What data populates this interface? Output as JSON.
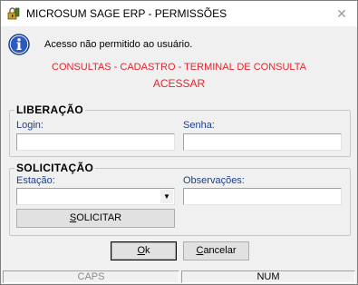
{
  "window": {
    "title": "MICROSUM SAGE ERP - PERMISSÕES",
    "close_glyph": "✕"
  },
  "message": {
    "text": "Acesso não permitido ao usuário.",
    "permission_path": "CONSULTAS - CADASTRO - TERMINAL DE CONSULTA",
    "permission_name": "ACESSAR",
    "accent_color": "#e3262c"
  },
  "liberacao": {
    "legend": "LIBERAÇÃO",
    "login_label": "Login:",
    "login_value": "",
    "senha_label": "Senha:",
    "senha_value": ""
  },
  "solicitacao": {
    "legend": "SOLICITAÇÃO",
    "estacao_label": "Estação:",
    "estacao_value": "",
    "observacoes_label": "Observações:",
    "observacoes_value": "",
    "solicitar_button": "SOLICITAR"
  },
  "buttons": {
    "ok": "Ok",
    "cancelar": "Cancelar"
  },
  "statusbar": {
    "caps": "CAPS",
    "num": "NUM"
  },
  "icons": {
    "app": "key-lock-icon",
    "info": "info-icon",
    "combo": "chevron-down-icon"
  }
}
